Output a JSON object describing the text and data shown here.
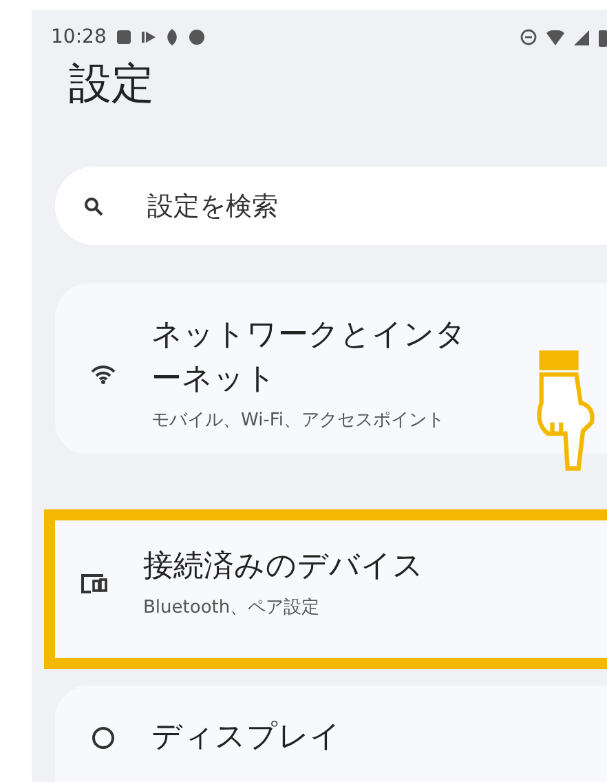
{
  "status_bar": {
    "time": "10:28"
  },
  "title": "設定",
  "search": {
    "placeholder": "設定を検索"
  },
  "items": [
    {
      "kind": "wifi",
      "title": "ネットワークとインターネット",
      "subtitle": "モバイル、Wi-Fi、アクセスポイント",
      "highlighted": false,
      "hand_pointer": true
    },
    {
      "kind": "devices",
      "title": "接続済みのデバイス",
      "subtitle": "Bluetooth、ペア設定",
      "highlighted": true,
      "hand_pointer": false
    },
    {
      "kind": "display",
      "title": "ディスプレイ",
      "highlighted": false,
      "hand_pointer": false
    }
  ]
}
